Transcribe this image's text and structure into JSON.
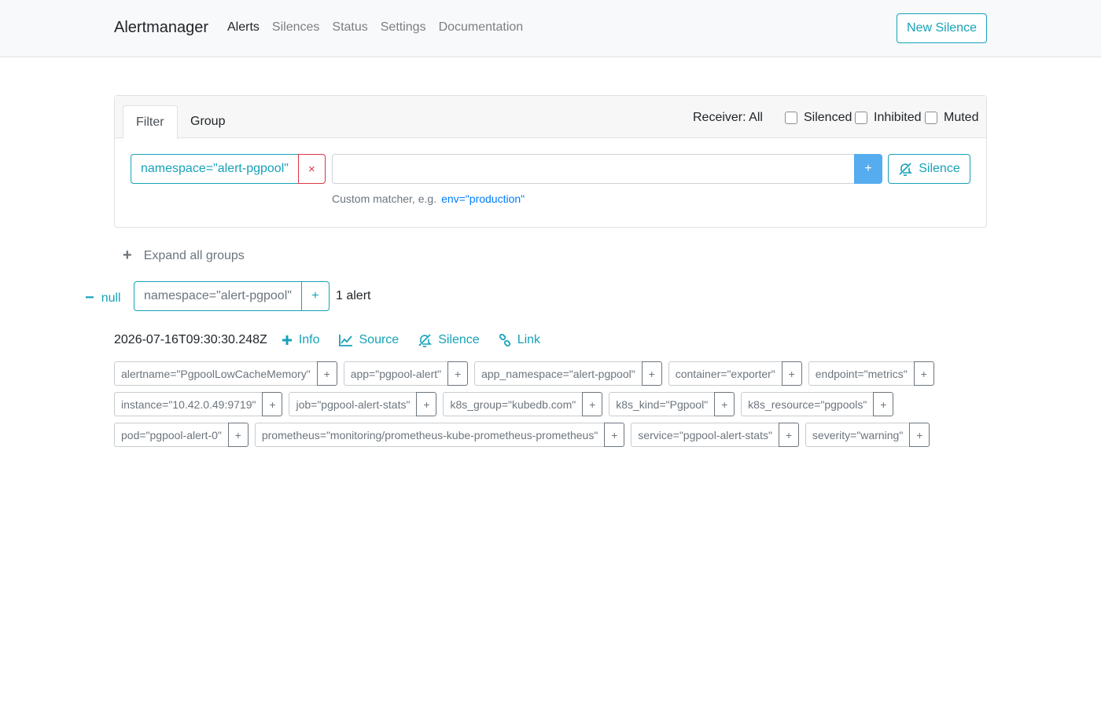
{
  "navbar": {
    "brand": "Alertmanager",
    "links": [
      "Alerts",
      "Silences",
      "Status",
      "Settings",
      "Documentation"
    ],
    "active": "Alerts",
    "new_silence_label": "New Silence"
  },
  "filter": {
    "tabs": [
      "Filter",
      "Group"
    ],
    "receiver": "Receiver: All",
    "checkboxes": [
      "Silenced",
      "Inhibited",
      "Muted"
    ],
    "matcher": "namespace=\"alert-pgpool\"",
    "remove_label": "×",
    "input_value": "",
    "add_label": "+",
    "silence_label": "Silence",
    "hint": "Custom matcher, e.g.",
    "hint_example": "env=\"production\""
  },
  "expand_all": "Expand all groups",
  "group": {
    "receiver": "null",
    "matcher": "namespace=\"alert-pgpool\"",
    "add_label": "+",
    "count": "1 alert"
  },
  "alert": {
    "timestamp": "2026-07-16T09:30:30.248Z",
    "actions": [
      "Info",
      "Source",
      "Silence",
      "Link"
    ],
    "label_rows": [
      [
        "alertname=\"PgpoolLowCacheMemory\"",
        "app=\"pgpool-alert\"",
        "app_namespace=\"alert-pgpool\"",
        "container=\"exporter\"",
        "endpoint=\"metrics\""
      ],
      [
        "instance=\"10.42.0.49:9719\"",
        "job=\"pgpool-alert-stats\"",
        "k8s_group=\"kubedb.com\"",
        "k8s_kind=\"Pgpool\"",
        "k8s_resource=\"pgpools\""
      ],
      [
        "pod=\"pgpool-alert-0\"",
        "prometheus=\"monitoring/prometheus-kube-prometheus-prometheus\"",
        "service=\"pgpool-alert-stats\"",
        "severity=\"warning\""
      ]
    ],
    "label_add": "+"
  },
  "colors": {
    "accent": "#17a2b8",
    "danger": "#dc3545",
    "link": "#007bff"
  }
}
